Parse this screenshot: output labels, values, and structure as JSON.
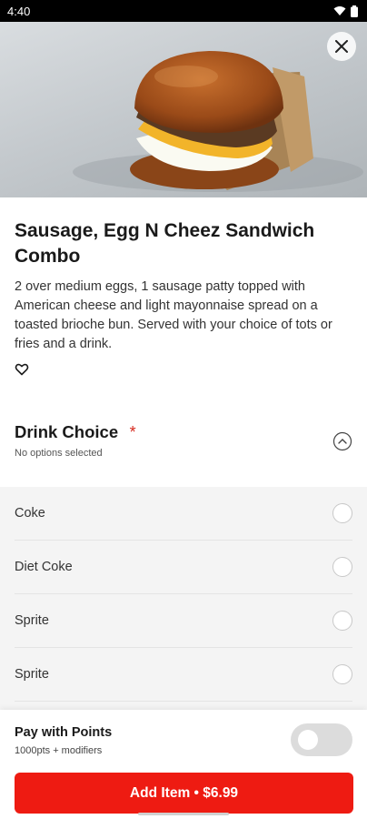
{
  "status_bar": {
    "time": "4:40"
  },
  "hero": {
    "image_alt": "Sausage egg cheese sandwich in paper wrap"
  },
  "item": {
    "title": "Sausage, Egg N Cheez Sandwich Combo",
    "description": "2 over medium eggs, 1 sausage patty topped with American cheese and light mayonnaise spread on a toasted brioche bun. Served with your choice of tots or fries and a drink."
  },
  "drink_section": {
    "title": "Drink Choice",
    "required_mark": "*",
    "subtitle": "No options selected",
    "options": [
      {
        "label": "Coke"
      },
      {
        "label": "Diet Coke"
      },
      {
        "label": "Sprite"
      },
      {
        "label": "Sprite"
      }
    ]
  },
  "points": {
    "title": "Pay with Points",
    "subtitle": "1000pts + modifiers",
    "enabled": false
  },
  "cta": {
    "label": "Add Item • $6.99"
  },
  "colors": {
    "accent": "#ee1b12",
    "required": "#d62b1f",
    "options_bg": "#f4f4f4"
  },
  "icons": [
    "wifi-icon",
    "battery-icon",
    "close-icon",
    "heart-icon",
    "chevron-up-icon"
  ]
}
